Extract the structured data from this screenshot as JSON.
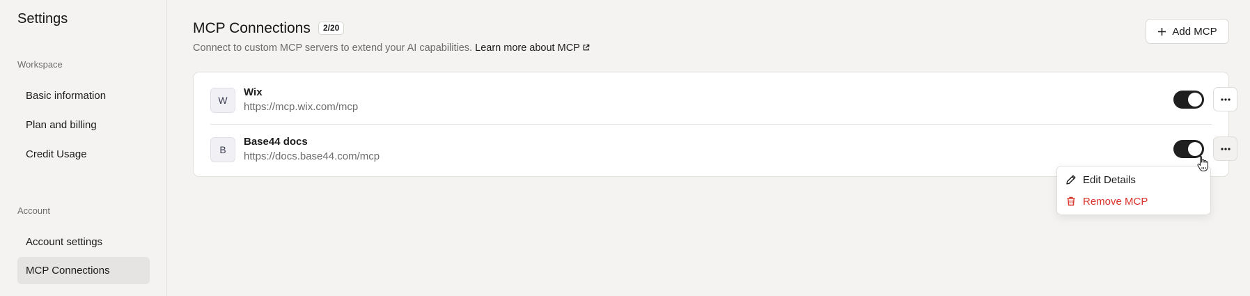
{
  "sidebar": {
    "title": "Settings",
    "sections": [
      {
        "label": "Workspace",
        "items": [
          {
            "label": "Basic information"
          },
          {
            "label": "Plan and billing"
          },
          {
            "label": "Credit Usage"
          }
        ]
      },
      {
        "label": "Account",
        "items": [
          {
            "label": "Account settings"
          },
          {
            "label": "MCP Connections",
            "active": true
          }
        ]
      }
    ]
  },
  "main": {
    "title": "MCP Connections",
    "count_badge": "2/20",
    "subtitle": "Connect to custom MCP servers to extend your AI capabilities.",
    "learn_more": "Learn more about MCP",
    "add_button": "Add MCP",
    "connections": [
      {
        "initial": "W",
        "name": "Wix",
        "url": "https://mcp.wix.com/mcp",
        "enabled": true
      },
      {
        "initial": "B",
        "name": "Base44 docs",
        "url": "https://docs.base44.com/mcp",
        "enabled": true
      }
    ],
    "menu": {
      "edit": "Edit Details",
      "remove": "Remove MCP"
    }
  },
  "colors": {
    "background": "#f4f3f1",
    "toggle_on": "#1f1f1f",
    "danger": "#d9342b"
  },
  "icons": [
    "plus-icon",
    "external-link-icon",
    "more-horizontal-icon",
    "pencil-icon",
    "trash-icon",
    "hand-pointer-icon"
  ]
}
